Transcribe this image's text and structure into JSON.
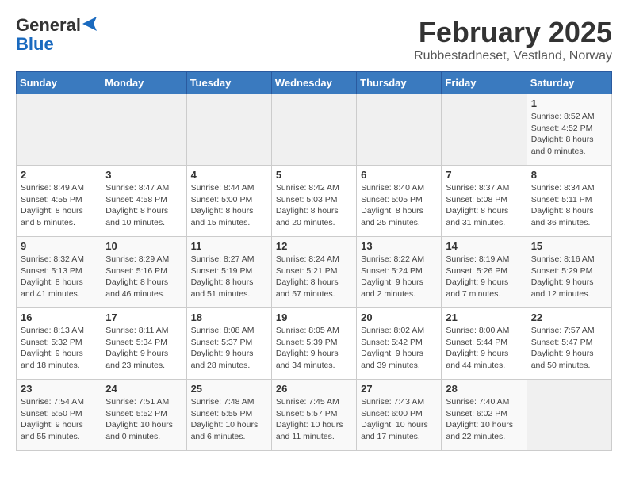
{
  "header": {
    "logo_general": "General",
    "logo_blue": "Blue",
    "title": "February 2025",
    "subtitle": "Rubbestadneset, Vestland, Norway"
  },
  "weekdays": [
    "Sunday",
    "Monday",
    "Tuesday",
    "Wednesday",
    "Thursday",
    "Friday",
    "Saturday"
  ],
  "weeks": [
    [
      {
        "day": "",
        "detail": ""
      },
      {
        "day": "",
        "detail": ""
      },
      {
        "day": "",
        "detail": ""
      },
      {
        "day": "",
        "detail": ""
      },
      {
        "day": "",
        "detail": ""
      },
      {
        "day": "",
        "detail": ""
      },
      {
        "day": "1",
        "detail": "Sunrise: 8:52 AM\nSunset: 4:52 PM\nDaylight: 8 hours and 0 minutes."
      }
    ],
    [
      {
        "day": "2",
        "detail": "Sunrise: 8:49 AM\nSunset: 4:55 PM\nDaylight: 8 hours and 5 minutes."
      },
      {
        "day": "3",
        "detail": "Sunrise: 8:47 AM\nSunset: 4:58 PM\nDaylight: 8 hours and 10 minutes."
      },
      {
        "day": "4",
        "detail": "Sunrise: 8:44 AM\nSunset: 5:00 PM\nDaylight: 8 hours and 15 minutes."
      },
      {
        "day": "5",
        "detail": "Sunrise: 8:42 AM\nSunset: 5:03 PM\nDaylight: 8 hours and 20 minutes."
      },
      {
        "day": "6",
        "detail": "Sunrise: 8:40 AM\nSunset: 5:05 PM\nDaylight: 8 hours and 25 minutes."
      },
      {
        "day": "7",
        "detail": "Sunrise: 8:37 AM\nSunset: 5:08 PM\nDaylight: 8 hours and 31 minutes."
      },
      {
        "day": "8",
        "detail": "Sunrise: 8:34 AM\nSunset: 5:11 PM\nDaylight: 8 hours and 36 minutes."
      }
    ],
    [
      {
        "day": "9",
        "detail": "Sunrise: 8:32 AM\nSunset: 5:13 PM\nDaylight: 8 hours and 41 minutes."
      },
      {
        "day": "10",
        "detail": "Sunrise: 8:29 AM\nSunset: 5:16 PM\nDaylight: 8 hours and 46 minutes."
      },
      {
        "day": "11",
        "detail": "Sunrise: 8:27 AM\nSunset: 5:19 PM\nDaylight: 8 hours and 51 minutes."
      },
      {
        "day": "12",
        "detail": "Sunrise: 8:24 AM\nSunset: 5:21 PM\nDaylight: 8 hours and 57 minutes."
      },
      {
        "day": "13",
        "detail": "Sunrise: 8:22 AM\nSunset: 5:24 PM\nDaylight: 9 hours and 2 minutes."
      },
      {
        "day": "14",
        "detail": "Sunrise: 8:19 AM\nSunset: 5:26 PM\nDaylight: 9 hours and 7 minutes."
      },
      {
        "day": "15",
        "detail": "Sunrise: 8:16 AM\nSunset: 5:29 PM\nDaylight: 9 hours and 12 minutes."
      }
    ],
    [
      {
        "day": "16",
        "detail": "Sunrise: 8:13 AM\nSunset: 5:32 PM\nDaylight: 9 hours and 18 minutes."
      },
      {
        "day": "17",
        "detail": "Sunrise: 8:11 AM\nSunset: 5:34 PM\nDaylight: 9 hours and 23 minutes."
      },
      {
        "day": "18",
        "detail": "Sunrise: 8:08 AM\nSunset: 5:37 PM\nDaylight: 9 hours and 28 minutes."
      },
      {
        "day": "19",
        "detail": "Sunrise: 8:05 AM\nSunset: 5:39 PM\nDaylight: 9 hours and 34 minutes."
      },
      {
        "day": "20",
        "detail": "Sunrise: 8:02 AM\nSunset: 5:42 PM\nDaylight: 9 hours and 39 minutes."
      },
      {
        "day": "21",
        "detail": "Sunrise: 8:00 AM\nSunset: 5:44 PM\nDaylight: 9 hours and 44 minutes."
      },
      {
        "day": "22",
        "detail": "Sunrise: 7:57 AM\nSunset: 5:47 PM\nDaylight: 9 hours and 50 minutes."
      }
    ],
    [
      {
        "day": "23",
        "detail": "Sunrise: 7:54 AM\nSunset: 5:50 PM\nDaylight: 9 hours and 55 minutes."
      },
      {
        "day": "24",
        "detail": "Sunrise: 7:51 AM\nSunset: 5:52 PM\nDaylight: 10 hours and 0 minutes."
      },
      {
        "day": "25",
        "detail": "Sunrise: 7:48 AM\nSunset: 5:55 PM\nDaylight: 10 hours and 6 minutes."
      },
      {
        "day": "26",
        "detail": "Sunrise: 7:45 AM\nSunset: 5:57 PM\nDaylight: 10 hours and 11 minutes."
      },
      {
        "day": "27",
        "detail": "Sunrise: 7:43 AM\nSunset: 6:00 PM\nDaylight: 10 hours and 17 minutes."
      },
      {
        "day": "28",
        "detail": "Sunrise: 7:40 AM\nSunset: 6:02 PM\nDaylight: 10 hours and 22 minutes."
      },
      {
        "day": "",
        "detail": ""
      }
    ]
  ]
}
